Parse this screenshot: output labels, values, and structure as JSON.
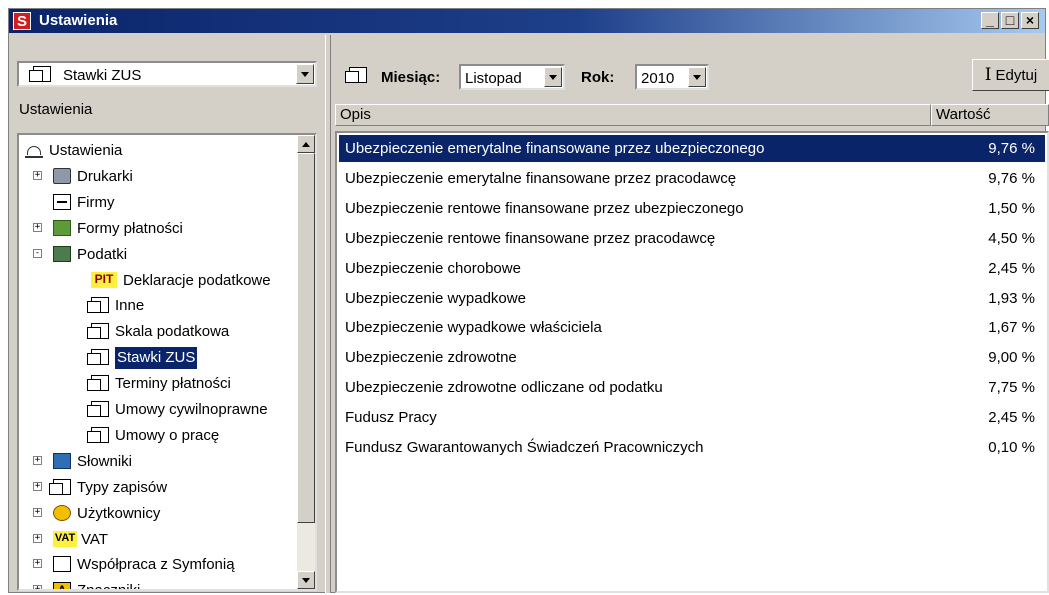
{
  "window": {
    "title": "Ustawienia",
    "app_icon": "S"
  },
  "left": {
    "combo_value": "Stawki ZUS",
    "section_label": "Ustawienia",
    "tree": [
      {
        "label": "Ustawienia",
        "icon": "settings-icon",
        "expander": ""
      },
      {
        "label": "Drukarki",
        "icon": "printer-icon",
        "expander": "+"
      },
      {
        "label": "Firmy",
        "icon": "card-icon",
        "expander": ""
      },
      {
        "label": "Formy płatności",
        "icon": "money-icon",
        "expander": "+"
      },
      {
        "label": "Podatki",
        "icon": "calculator-icon",
        "expander": "-"
      },
      {
        "label": "Deklaracje podatkowe",
        "icon": "pit-icon",
        "badge": "PIT"
      },
      {
        "label": "Inne",
        "icon": "document-icon"
      },
      {
        "label": "Skala podatkowa",
        "icon": "document-icon"
      },
      {
        "label": "Stawki ZUS",
        "icon": "document-icon",
        "selected": true
      },
      {
        "label": "Terminy płatności",
        "icon": "document-icon"
      },
      {
        "label": "Umowy cywilnoprawne",
        "icon": "document-icon"
      },
      {
        "label": "Umowy o pracę",
        "icon": "document-icon"
      },
      {
        "label": "Słowniki",
        "icon": "dictionary-icon",
        "expander": "+"
      },
      {
        "label": "Typy zapisów",
        "icon": "document-icon",
        "expander": "+"
      },
      {
        "label": "Użytkownicy",
        "icon": "users-icon",
        "expander": "+"
      },
      {
        "label": "VAT",
        "icon": "vat-icon",
        "expander": "+",
        "badge": "VAT"
      },
      {
        "label": "Współpraca z Symfonią",
        "icon": "sync-icon",
        "expander": "+"
      },
      {
        "label": "Znaczniki",
        "icon": "tag-icon",
        "expander": "+",
        "badge": "A"
      }
    ]
  },
  "toolbar": {
    "month_label": "Miesiąc:",
    "month_value": "Listopad",
    "year_label": "Rok:",
    "year_value": "2010",
    "edit_label": "Edytuj"
  },
  "table": {
    "columns": [
      "Opis",
      "Wartość"
    ],
    "rows": [
      {
        "desc": "Ubezpieczenie emerytalne finansowane przez ubezpieczonego",
        "value": "9,76 %",
        "selected": true
      },
      {
        "desc": "Ubezpieczenie emerytalne finansowane przez pracodawcę",
        "value": "9,76 %"
      },
      {
        "desc": "Ubezpieczenie rentowe finansowane przez ubezpieczonego",
        "value": "1,50 %"
      },
      {
        "desc": "Ubezpieczenie rentowe finansowane przez pracodawcę",
        "value": "4,50 %"
      },
      {
        "desc": "Ubezpieczenie chorobowe",
        "value": "2,45 %"
      },
      {
        "desc": "Ubezpieczenie wypadkowe",
        "value": "1,93 %"
      },
      {
        "desc": "Ubezpieczenie wypadkowe właściciela",
        "value": "1,67 %"
      },
      {
        "desc": "Ubezpieczenie zdrowotne",
        "value": "9,00 %"
      },
      {
        "desc": "Ubezpieczenie zdrowotne odliczane od podatku",
        "value": "7,75 %"
      },
      {
        "desc": "Fudusz Pracy",
        "value": "2,45 %"
      },
      {
        "desc": "Fundusz Gwarantowanych Świadczeń Pracowniczych",
        "value": "0,10 %"
      }
    ]
  }
}
